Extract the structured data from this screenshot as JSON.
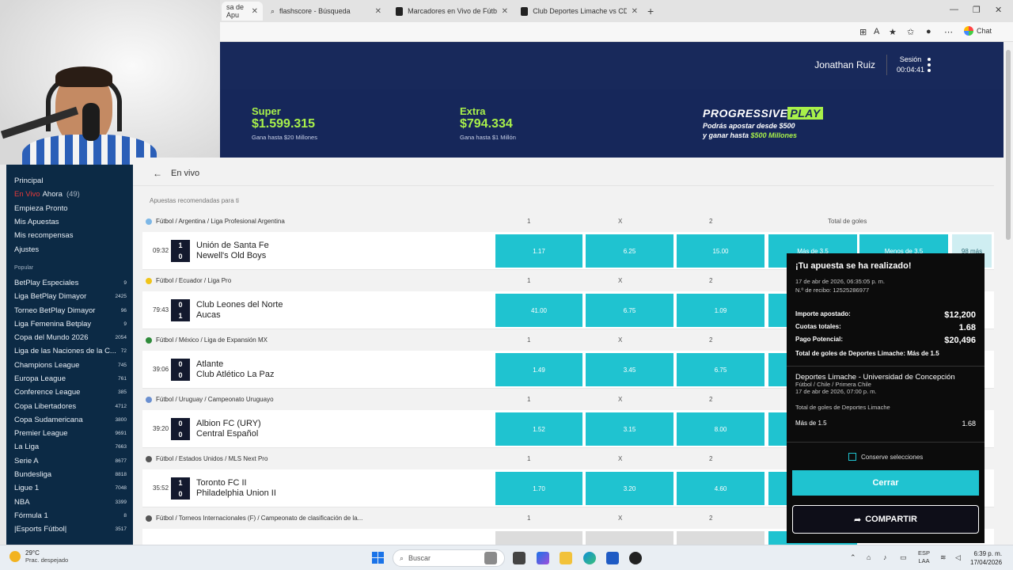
{
  "browser": {
    "tabs": [
      {
        "label": "sa de Apu",
        "active": true
      },
      {
        "label": "flashscore - Búsqueda",
        "active": false
      },
      {
        "label": "Marcadores en Vivo de Fútbol, Re",
        "active": false
      },
      {
        "label": "Club Deportes Limache vs CD Univ",
        "active": false
      }
    ],
    "new_tab": "+",
    "chat_label": "Chat"
  },
  "header": {
    "user_name": "Jonathan Ruiz",
    "session_label": "Sesión",
    "session_time": "00:04:41"
  },
  "promo": {
    "super_title": "Super",
    "super_amount": "$1.599.315",
    "super_sub": "Gana hasta $20 Millones",
    "extra_title": "Extra",
    "extra_amount": "$794.334",
    "extra_sub": "Gana hasta $1 Millón",
    "brand_a": "PROGRESSIVE",
    "brand_b": "PLAY",
    "desc_a": "Podrás apostar desde $500",
    "desc_b": "y ganar hasta ",
    "desc_c": "$500 Millones"
  },
  "sidebar": {
    "items": [
      {
        "label": "Principal"
      },
      {
        "live": "En Vivo",
        "label": "Ahora",
        "count": "(49)"
      },
      {
        "label": "Empieza Pronto"
      },
      {
        "label": "Mis Apuestas"
      },
      {
        "label": "Mis recompensas"
      },
      {
        "label": "Ajustes"
      }
    ],
    "section": "Popular",
    "popular": [
      {
        "label": "BetPlay Especiales",
        "count": "9"
      },
      {
        "label": "Liga BetPlay Dimayor",
        "count": "2425"
      },
      {
        "label": "Torneo BetPlay Dimayor",
        "count": "96"
      },
      {
        "label": "Liga Femenina Betplay",
        "count": "9"
      },
      {
        "label": "Copa del Mundo 2026",
        "count": "2054"
      },
      {
        "label": "Liga de las Naciones de la C...",
        "count": "72"
      },
      {
        "label": "Champions League",
        "count": "745"
      },
      {
        "label": "Europa League",
        "count": "761"
      },
      {
        "label": "Conference League",
        "count": "385"
      },
      {
        "label": "Copa Libertadores",
        "count": "4712"
      },
      {
        "label": "Copa Sudamericana",
        "count": "3800"
      },
      {
        "label": "Premier League",
        "count": "9691"
      },
      {
        "label": "La Liga",
        "count": "7663"
      },
      {
        "label": "Serie A",
        "count": "8677"
      },
      {
        "label": "Bundesliga",
        "count": "8818"
      },
      {
        "label": "Ligue 1",
        "count": "7048"
      },
      {
        "label": "NBA",
        "count": "3399"
      },
      {
        "label": "Fórmula 1",
        "count": "8"
      },
      {
        "label": "|Esports Fútbol|",
        "count": "3517"
      }
    ]
  },
  "main": {
    "back_label": "En vivo",
    "recommended": "Apuestas recomendadas para ti",
    "col_1": "1",
    "col_x": "X",
    "col_2": "2",
    "col_total": "Total de goles",
    "more_label": "98 más",
    "over_label": "Más de 3.5",
    "under_label": "Menos de 3.5",
    "matches": [
      {
        "league": "Fútbol / Argentina / Liga Profesional Argentina",
        "time": "09:32",
        "s1": "1",
        "s2": "0",
        "home": "Unión de Santa Fe",
        "away": "Newell's Old Boys",
        "o1": "1.17",
        "ox": "6.25",
        "o2": "15.00",
        "flag": "#7db7e6"
      },
      {
        "league": "Fútbol / Ecuador / Liga Pro",
        "time": "79:43",
        "s1": "0",
        "s2": "1",
        "home": "Club Leones del Norte",
        "away": "Aucas",
        "o1": "41.00",
        "ox": "6.75",
        "o2": "1.09",
        "flag": "#f0c419"
      },
      {
        "league": "Fútbol / México / Liga de Expansión MX",
        "time": "39:06",
        "s1": "0",
        "s2": "0",
        "home": "Atlante",
        "away": "Club Atlético La Paz",
        "o1": "1.49",
        "ox": "3.45",
        "o2": "6.75",
        "flag": "#2e8b3a"
      },
      {
        "league": "Fútbol / Uruguay / Campeonato Uruguayo",
        "time": "39:20",
        "s1": "0",
        "s2": "0",
        "home": "Albion FC (URY)",
        "away": "Central Español",
        "o1": "1.52",
        "ox": "3.15",
        "o2": "8.00",
        "flag": "#6a8fd0"
      },
      {
        "league": "Fútbol / Estados Unidos / MLS Next Pro",
        "time": "35:52",
        "s1": "1",
        "s2": "0",
        "home": "Toronto FC II",
        "away": "Philadelphia Union II",
        "o1": "1.70",
        "ox": "3.20",
        "o2": "4.60",
        "flag": "#555555"
      },
      {
        "league": "Fútbol / Torneos Internacionales (F) / Campeonato de clasificación de la...",
        "time": "",
        "s1": "",
        "s2": "",
        "home": "",
        "away": "",
        "o1": "",
        "ox": "",
        "o2": "",
        "flag": "#555555"
      }
    ]
  },
  "slip": {
    "title": "¡Tu apuesta se ha realizado!",
    "date": "17 de abr de 2026, 06:35:05 p. m.",
    "receipt": "N.º de recibo: 12525286977",
    "stake_label": "Importe apostado:",
    "stake": "$12,200",
    "odds_label": "Cuotas totales:",
    "odds": "1.68",
    "payout_label": "Pago Potencial:",
    "payout": "$20,496",
    "summary": "Total de goles de Deportes Limache: Más de 1.5",
    "event": "Deportes Limache - Universidad de Concepción",
    "event_league": "Fútbol / Chile / Primera Chile",
    "event_date": "17 de abr de 2026, 07:00 p. m.",
    "market": "Total de goles de Deportes Limache",
    "selection": "Más de 1.5",
    "selection_odds": "1.68",
    "keep_label": "Conserve selecciones",
    "close_label": "Cerrar",
    "share_label": "COMPARTIR"
  },
  "taskbar": {
    "temp": "29°C",
    "weather": "Prac. despejado",
    "search": "Buscar",
    "lang_a": "ESP",
    "lang_b": "LAA",
    "time": "6:39 p. m.",
    "date": "17/04/2026"
  }
}
